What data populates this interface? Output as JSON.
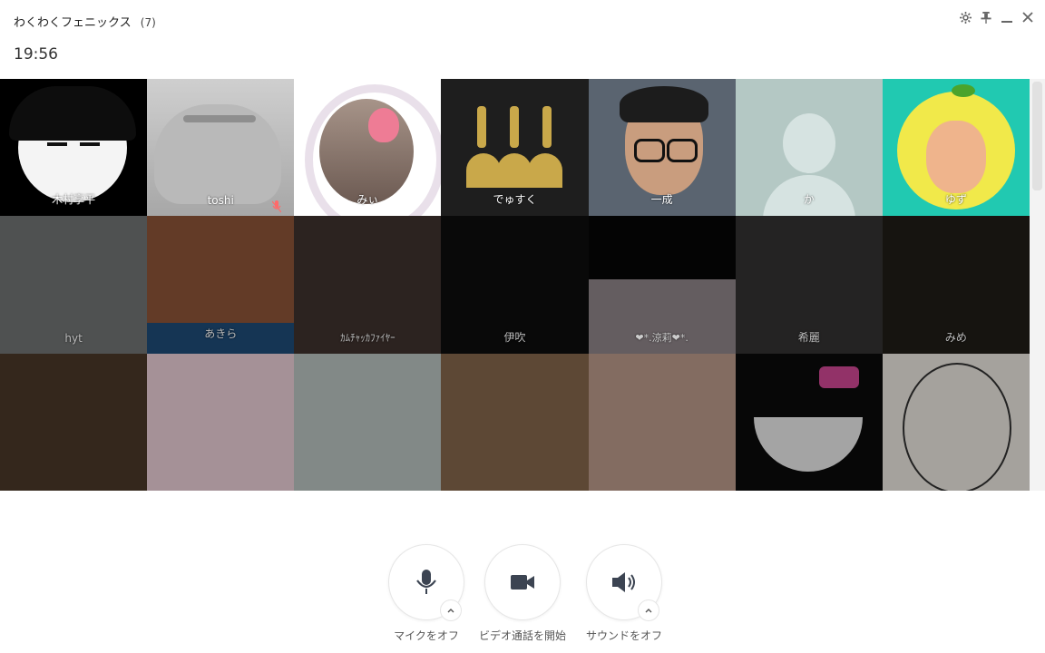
{
  "window": {
    "group_name": "わくわくフェニックス",
    "member_count": "(7)",
    "controls": [
      "gear-icon",
      "pin-icon",
      "minimize-icon",
      "close-icon"
    ]
  },
  "call": {
    "elapsed": "19:56"
  },
  "participants_active": [
    {
      "name": "木村享平"
    },
    {
      "name": "toshi",
      "muted": true
    },
    {
      "name": "みぃ"
    },
    {
      "name": "でゅすく"
    },
    {
      "name": "一成"
    },
    {
      "name": "か"
    },
    {
      "name": "ゆず"
    }
  ],
  "participants_dimmed": [
    {
      "name": "hyt"
    },
    {
      "name": "あきら"
    },
    {
      "name": "ｶﾑﾁｬｯｶﾌｧｲﾔｰ"
    },
    {
      "name": "伊吹"
    },
    {
      "name": "❤︎*.涼莉❤︎*."
    },
    {
      "name": "希麗"
    },
    {
      "name": "みめ"
    }
  ],
  "controls": {
    "mic": {
      "label": "マイクをオフ",
      "icon": "microphone-icon"
    },
    "video": {
      "label": "ビデオ通話を開始",
      "icon": "video-camera-icon"
    },
    "sound": {
      "label": "サウンドをオフ",
      "icon": "speaker-icon"
    }
  },
  "colors": {
    "icon": "#3c4452",
    "accent_teal": "#21c9b1",
    "mute_red": "#ff6a6a"
  }
}
